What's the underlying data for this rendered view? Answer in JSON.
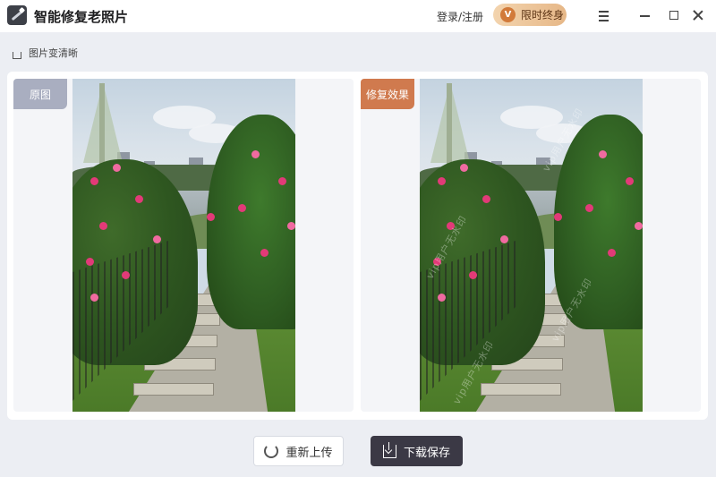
{
  "app": {
    "title": "智能修复老照片",
    "login_label": "登录/注册",
    "vip_label": "限时终身",
    "vip_icon_glyph": "V"
  },
  "breadcrumb": {
    "label": "图片变清晰"
  },
  "compare": {
    "original_tag": "原图",
    "restored_tag": "修复效果",
    "watermark_text": "vip用户无水印"
  },
  "actions": {
    "reupload_label": "重新上传",
    "download_label": "下载保存"
  },
  "colors": {
    "accent_dark": "#3b3945",
    "vip_gold": "#e6b787",
    "original_tag": "#a9aec0",
    "restored_tag": "#d07a4e"
  },
  "icons": [
    "app-logo-icon",
    "vip-icon",
    "menu-icon",
    "minimize-icon",
    "maximize-icon",
    "close-icon",
    "home-icon",
    "reupload-icon",
    "download-icon"
  ]
}
